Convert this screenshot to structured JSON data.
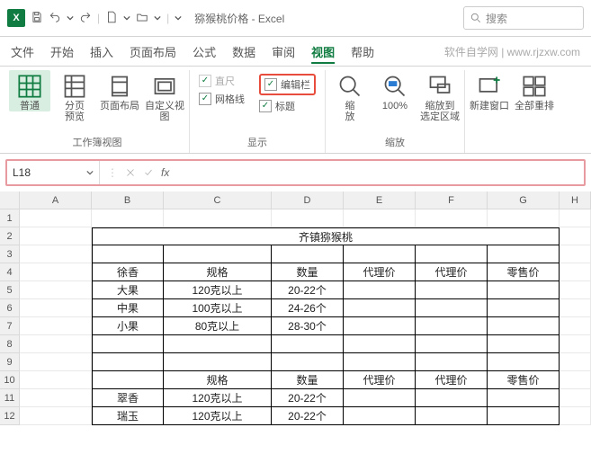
{
  "title": "猕猴桃价格 - Excel",
  "search_placeholder": "搜索",
  "tabs": {
    "file": "文件",
    "home": "开始",
    "insert": "插入",
    "layout": "页面布局",
    "formulas": "公式",
    "data": "数据",
    "review": "审阅",
    "view": "视图",
    "help": "帮助"
  },
  "hint": "软件自学网 | www.rjzxw.com",
  "ribbon": {
    "grp_views": {
      "label": "工作簿视图",
      "normal": "普通",
      "pagebreak": "分页\n预览",
      "pagelayout": "页面布局",
      "custom": "自定义视图"
    },
    "grp_show": {
      "label": "显示",
      "ruler": "直尺",
      "formula_bar": "编辑栏",
      "gridlines": "网格线",
      "headings": "标题"
    },
    "grp_zoom": {
      "label": "缩放",
      "zoom": "缩\n放",
      "z100": "100%",
      "zoom_selection": "缩放到\n选定区域"
    },
    "grp_window": {
      "new_window": "新建窗口",
      "arrange_all": "全部重排"
    }
  },
  "formula_bar": {
    "name_box": "L18",
    "fx": "fx",
    "value": ""
  },
  "grid": {
    "cols": [
      "A",
      "B",
      "C",
      "D",
      "E",
      "F",
      "G",
      "H"
    ],
    "row_numbers": [
      "1",
      "2",
      "3",
      "4",
      "5",
      "6",
      "7",
      "8",
      "9",
      "10",
      "11",
      "12"
    ],
    "merged_title": "齐镇猕猴桃",
    "r4": {
      "B": "徐香",
      "C": "规格",
      "D": "数量",
      "E": "代理价",
      "F": "代理价",
      "G": "零售价"
    },
    "r5": {
      "B": "大果",
      "C": "120克以上",
      "D": "20-22个"
    },
    "r6": {
      "B": "中果",
      "C": "100克以上",
      "D": "24-26个"
    },
    "r7": {
      "B": "小果",
      "C": "80克以上",
      "D": "28-30个"
    },
    "r10": {
      "C": "规格",
      "D": "数量",
      "E": "代理价",
      "F": "代理价",
      "G": "零售价"
    },
    "r11": {
      "B": "翠香",
      "C": "120克以上",
      "D": "20-22个"
    },
    "r12": {
      "B": "瑞玉",
      "C": "120克以上",
      "D": "20-22个"
    }
  },
  "chart_data": {
    "type": "table",
    "title": "齐镇猕猴桃",
    "sections": [
      {
        "variety": "徐香",
        "headers": [
          "规格",
          "数量",
          "代理价",
          "代理价",
          "零售价"
        ],
        "rows": [
          {
            "name": "大果",
            "spec": "120克以上",
            "qty": "20-22个"
          },
          {
            "name": "中果",
            "spec": "100克以上",
            "qty": "24-26个"
          },
          {
            "name": "小果",
            "spec": "80克以上",
            "qty": "28-30个"
          }
        ]
      },
      {
        "variety": "",
        "headers": [
          "规格",
          "数量",
          "代理价",
          "代理价",
          "零售价"
        ],
        "rows": [
          {
            "name": "翠香",
            "spec": "120克以上",
            "qty": "20-22个"
          },
          {
            "name": "瑞玉",
            "spec": "120克以上",
            "qty": "20-22个"
          }
        ]
      }
    ]
  }
}
